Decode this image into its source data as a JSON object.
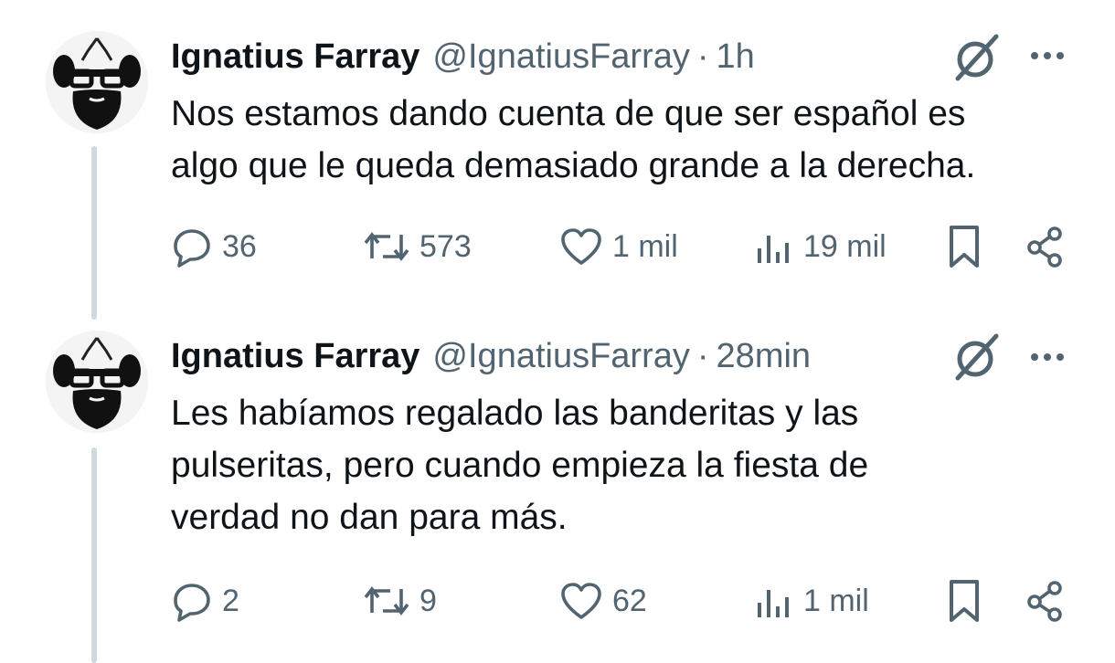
{
  "tweets": [
    {
      "name": "Ignatius Farray",
      "handle": "@IgnatiusFarray",
      "separator": "·",
      "time": "1h",
      "text_lines": [
        "Nos estamos dando cuenta de que ser español es",
        "algo que le queda demasiado grande a la derecha."
      ],
      "replies": "36",
      "retweets": "573",
      "likes": "1 mil",
      "views": "19 mil"
    },
    {
      "name": "Ignatius Farray",
      "handle": "@IgnatiusFarray",
      "separator": "·",
      "time": "28min",
      "text_lines": [
        "Les habíamos regalado las banderitas y las",
        "pulseritas, pero cuando empieza la fiesta de",
        "verdad no dan para más."
      ],
      "replies": "2",
      "retweets": "9",
      "likes": "62",
      "views": "1 mil"
    }
  ],
  "icons": {
    "reply": "reply-icon",
    "retweet": "retweet-icon",
    "like": "heart-icon",
    "views": "views-icon",
    "bookmark": "bookmark-icon",
    "share": "share-icon",
    "grok": "grok-icon",
    "more": "more-icon"
  },
  "colors": {
    "text": "#0f1419",
    "secondary": "#536471",
    "thread_line": "#cfd9de"
  }
}
